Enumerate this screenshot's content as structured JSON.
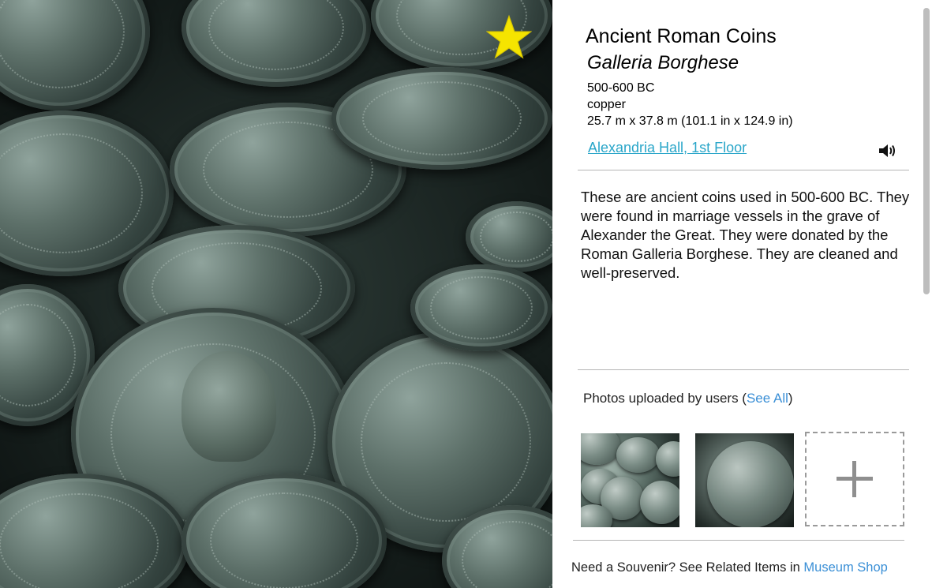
{
  "artifact": {
    "title": "Ancient Roman Coins",
    "collection": "Galleria Borghese",
    "date": "500-600 BC",
    "material": "copper",
    "dimensions": "25.7 m x 37.8 m (101.1 in x 124.9 in)",
    "location": "Alexandria Hall, 1st Floor",
    "favorite": true,
    "description": "These are ancient coins used in 500-600 BC. They were found in marriage vessels in the grave of Alexander the Great. They were donated by the Roman Galleria Borghese. They are cleaned and well-preserved."
  },
  "icons": {
    "favorite": "star-icon",
    "audio": "speaker-icon",
    "add_photo": "plus-icon"
  },
  "colors": {
    "star": "#f5e400",
    "link": "#3a8fd6",
    "location_link": "#2aa6c9"
  },
  "photos": {
    "heading_prefix": "Photos uploaded by users (",
    "see_all": "See All",
    "heading_suffix": ")"
  },
  "footer": {
    "souvenir_text": "Need a Souvenir? See Related Items in ",
    "shop_link": "Museum Shop"
  }
}
